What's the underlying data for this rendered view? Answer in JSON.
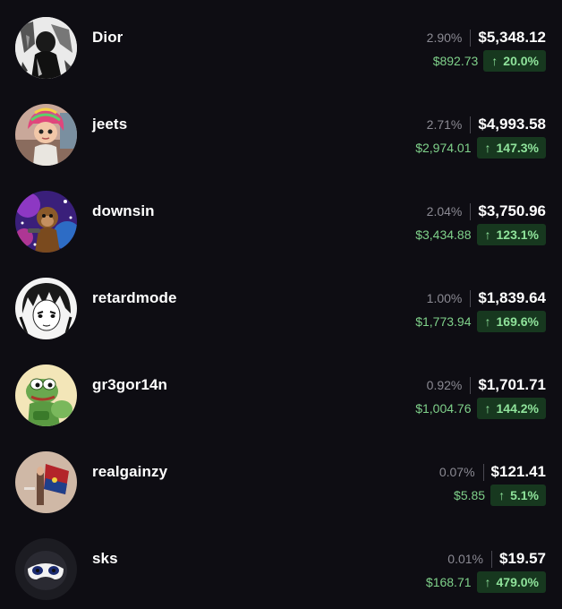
{
  "accent_colors": {
    "background": "#0e0d13",
    "gain_text": "#7fd18a",
    "badge_background": "#17381f",
    "badge_text": "#8fe39b",
    "muted_text": "#8b8a93"
  },
  "holders": [
    {
      "name": "Dior",
      "percent": "2.90%",
      "value": "$5,348.12",
      "gain": "$892.73",
      "change": "20.0%",
      "arrow_icon": "arrow-up-icon",
      "avatar_icon": "avatar-bw-figure-icon"
    },
    {
      "name": "jeets",
      "percent": "2.71%",
      "value": "$4,993.58",
      "gain": "$2,974.01",
      "change": "147.3%",
      "arrow_icon": "arrow-up-icon",
      "avatar_icon": "avatar-rainbow-hair-icon"
    },
    {
      "name": "downsin",
      "percent": "2.04%",
      "value": "$3,750.96",
      "gain": "$3,434.88",
      "change": "123.1%",
      "arrow_icon": "arrow-up-icon",
      "avatar_icon": "avatar-space-monkey-icon"
    },
    {
      "name": "retardmode",
      "percent": "1.00%",
      "value": "$1,839.64",
      "gain": "$1,773.94",
      "change": "169.6%",
      "arrow_icon": "arrow-up-icon",
      "avatar_icon": "avatar-manga-face-icon"
    },
    {
      "name": "gr3gor14n",
      "percent": "0.92%",
      "value": "$1,701.71",
      "gain": "$1,004.76",
      "change": "144.2%",
      "arrow_icon": "arrow-up-icon",
      "avatar_icon": "avatar-green-frog-icon"
    },
    {
      "name": "realgainzy",
      "percent": "0.07%",
      "value": "$121.41",
      "gain": "$5.85",
      "change": "5.1%",
      "arrow_icon": "arrow-up-icon",
      "avatar_icon": "avatar-red-flag-icon"
    },
    {
      "name": "sks",
      "percent": "0.01%",
      "value": "$19.57",
      "gain": "$168.71",
      "change": "479.0%",
      "arrow_icon": "arrow-up-icon",
      "avatar_icon": "avatar-mask-icon"
    }
  ]
}
